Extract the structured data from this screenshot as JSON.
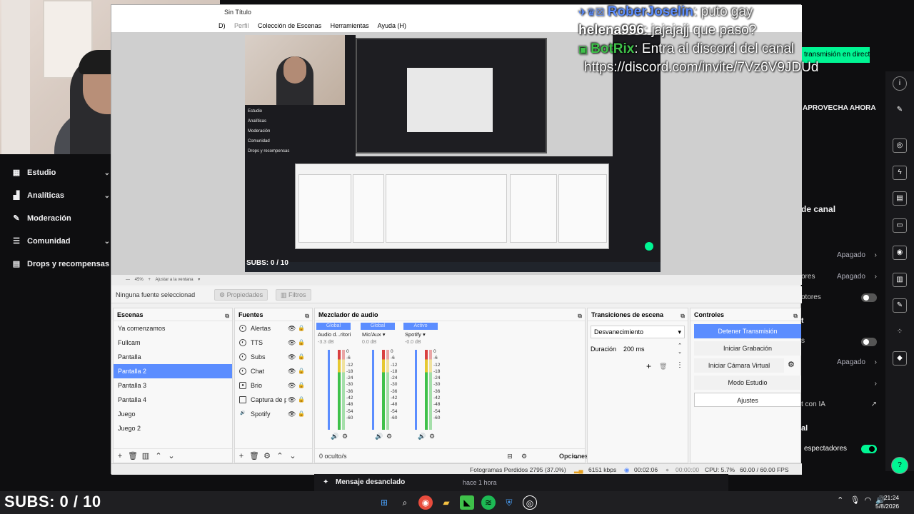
{
  "dashboard": {
    "nav": [
      {
        "label": "Estudio",
        "icon": "studio-icon"
      },
      {
        "label": "Analíticas",
        "icon": "analytics-icon"
      },
      {
        "label": "Moderación",
        "icon": "wrench-icon"
      },
      {
        "label": "Comunidad",
        "icon": "community-icon"
      },
      {
        "label": "Drops y recompensas",
        "icon": "drops-icon"
      }
    ],
    "live_pill": "transmisión en directo",
    "promo": "APROVECHA AHORA",
    "section_channel": "de canal",
    "rows": [
      {
        "label": "",
        "value": "Apagado"
      },
      {
        "label": "ores",
        "value": "Apagado"
      },
      {
        "label": "otores",
        "value": ""
      },
      {
        "label": "t",
        "value": ""
      },
      {
        "label": "s",
        "value": ""
      },
      {
        "label": "",
        "value": "Apagado"
      },
      {
        "label": "t con IA",
        "value": ""
      }
    ],
    "section_al": "al",
    "spectators": "espectadores"
  },
  "chat_overlay": {
    "lines": [
      {
        "name": "RoberJoselin",
        "text": ": puto gay",
        "color": "#5b8dff"
      },
      {
        "name": "helena996",
        "text": ": jajajajj que paso?",
        "color": "#ffffff"
      },
      {
        "name": "BotRix",
        "text": ": Entra al discord del canal",
        "color": "#3fc14a"
      },
      {
        "name": "",
        "text": "https://discord.com/invite/7Vz6V9JDUd",
        "color": "#ffffff"
      }
    ]
  },
  "obs": {
    "title": "Sin Título",
    "menu": [
      "D)",
      "Perfil",
      "Colección de Escenas",
      "Herramientas",
      "Ayuda (H)"
    ],
    "preview_subs": "SUBS: 0 / 10",
    "zoom_bar": {
      "zoom": "45%",
      "fit": "Ajustar a la ventana"
    },
    "source_bar": {
      "none": "Ninguna fuente seleccionad",
      "properties": "Propiedades",
      "filters": "Filtros"
    },
    "scenes": {
      "title": "Escenas",
      "items": [
        "Ya comenzamos",
        "Fullcam",
        "Pantalla",
        "Pantalla 2",
        "Pantalla 3",
        "Pantalla 4",
        "Juego",
        "Juego 2"
      ],
      "selected": "Pantalla 2"
    },
    "sources": {
      "title": "Fuentes",
      "items": [
        "Alertas",
        "TTS",
        "Subs",
        "Chat",
        "Brio",
        "Captura de p",
        "Spotify"
      ]
    },
    "mixer": {
      "title": "Mezclador de audio",
      "channels": [
        {
          "tag": "Global",
          "name": "Audio d...ritorio",
          "db": "-3.3 dB"
        },
        {
          "tag": "Global",
          "name": "Mic/Aux",
          "db": "0.0 dB"
        },
        {
          "tag": "Activo",
          "name": "Spotify",
          "db": "-0.0 dB"
        }
      ],
      "scale": [
        "0",
        "-6",
        "-12",
        "-18",
        "-24",
        "-30",
        "-36",
        "-42",
        "-48",
        "-54",
        "-60"
      ],
      "hidden": "0 oculto/s",
      "options": "Opciones"
    },
    "transitions": {
      "title": "Transiciones de escena",
      "type": "Desvanecimiento",
      "duration_label": "Duración",
      "duration_value": "200 ms"
    },
    "controls": {
      "title": "Controles",
      "stop_stream": "Detener Transmisión",
      "start_record": "Iniciar Grabación",
      "virtual_cam": "Iniciar Cámara Virtual",
      "studio_mode": "Modo Estudio",
      "settings": "Ajustes"
    },
    "status": {
      "dropped": "Fotogramas Perdidos 2795 (37.0%)",
      "kbps": "6151 kbps",
      "stream_time": "00:02:06",
      "rec_time": "00:00:00",
      "cpu": "CPU: 5.7%",
      "fps": "60.00 / 60.00 FPS"
    }
  },
  "bg_chat": {
    "title": "Mensaje desanclado",
    "time": "hace 1 hora"
  },
  "bottom_subs": "SUBS: 0 / 10",
  "clock": {
    "time": "21:24",
    "date": "5/8/2026"
  }
}
